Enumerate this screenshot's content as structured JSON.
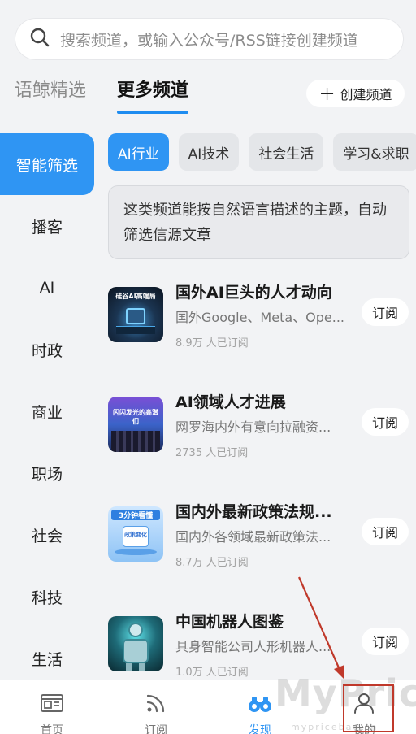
{
  "search": {
    "placeholder": "搜索频道，或输入公众号/RSS链接创建频道",
    "icon": "search-icon"
  },
  "tabs": [
    {
      "label": "语鲸精选",
      "active": false
    },
    {
      "label": "更多频道",
      "active": true
    }
  ],
  "create_button": {
    "label": "创建频道",
    "icon": "plus-icon"
  },
  "sidebar": {
    "items": [
      {
        "label": "智能筛选",
        "active": true
      },
      {
        "label": "播客"
      },
      {
        "label": "AI"
      },
      {
        "label": "时政"
      },
      {
        "label": "商业"
      },
      {
        "label": "职场"
      },
      {
        "label": "社会"
      },
      {
        "label": "科技"
      },
      {
        "label": "生活"
      }
    ]
  },
  "chips": [
    {
      "label": "AI行业",
      "active": true
    },
    {
      "label": "AI技术"
    },
    {
      "label": "社会生活"
    },
    {
      "label": "学习&求职"
    }
  ],
  "description": "这类频道能按自然语言描述的主题，自动筛选信源文章",
  "channels": [
    {
      "title": "国外AI巨头的人才动向",
      "subtitle": "国外Google、Meta、Ope...",
      "count": "8.9万 人已订阅",
      "button": "订阅",
      "thumb_text": "硅谷AI高端局"
    },
    {
      "title": "AI领域人才进展",
      "subtitle": "网罗海内外有意向拉融资...",
      "count": "2735 人已订阅",
      "button": "订阅",
      "thumb_text": "闪闪发光的高潜们"
    },
    {
      "title": "国内外最新政策法规...",
      "subtitle": "国内外各领域最新政策法...",
      "count": "8.7万 人已订阅",
      "button": "订阅",
      "thumb_text": "3分钟看懂",
      "thumb_text2": "政策变化"
    },
    {
      "title": "中国机器人图鉴",
      "subtitle": "具身智能公司人形机器人...",
      "count": "1.0万 人已订阅",
      "button": "订阅"
    }
  ],
  "bottom_nav": [
    {
      "label": "首页",
      "icon": "home-icon"
    },
    {
      "label": "订阅",
      "icon": "rss-icon"
    },
    {
      "label": "发现",
      "icon": "binoculars-icon",
      "active": true
    },
    {
      "label": "我的",
      "icon": "user-icon"
    }
  ],
  "watermark": {
    "text": "MyPrice",
    "sub": "mypricebao.cn"
  },
  "colors": {
    "accent": "#2f95f3",
    "annotation": "#c0392b"
  }
}
